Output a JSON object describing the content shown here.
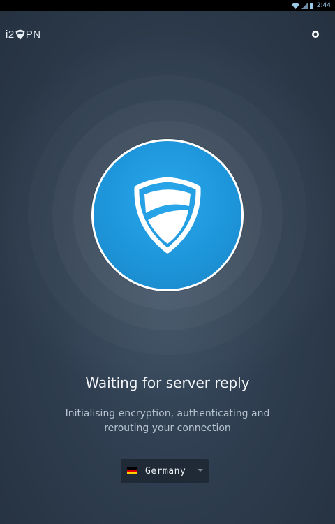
{
  "status_bar": {
    "time": "2:44"
  },
  "app": {
    "logo_prefix": "i2",
    "logo_suffix": "PN"
  },
  "connection": {
    "title": "Waiting for server reply",
    "description_line1": "Initialising encryption, authenticating and",
    "description_line2": "rerouting your connection"
  },
  "location": {
    "country": "Germany",
    "flag_colors": [
      "#000000",
      "#dd0000",
      "#ffce00"
    ]
  },
  "colors": {
    "accent": "#1e95da",
    "background": "#2f3e50"
  },
  "icons": {
    "settings": "gear-icon",
    "shield": "shield-icon"
  }
}
